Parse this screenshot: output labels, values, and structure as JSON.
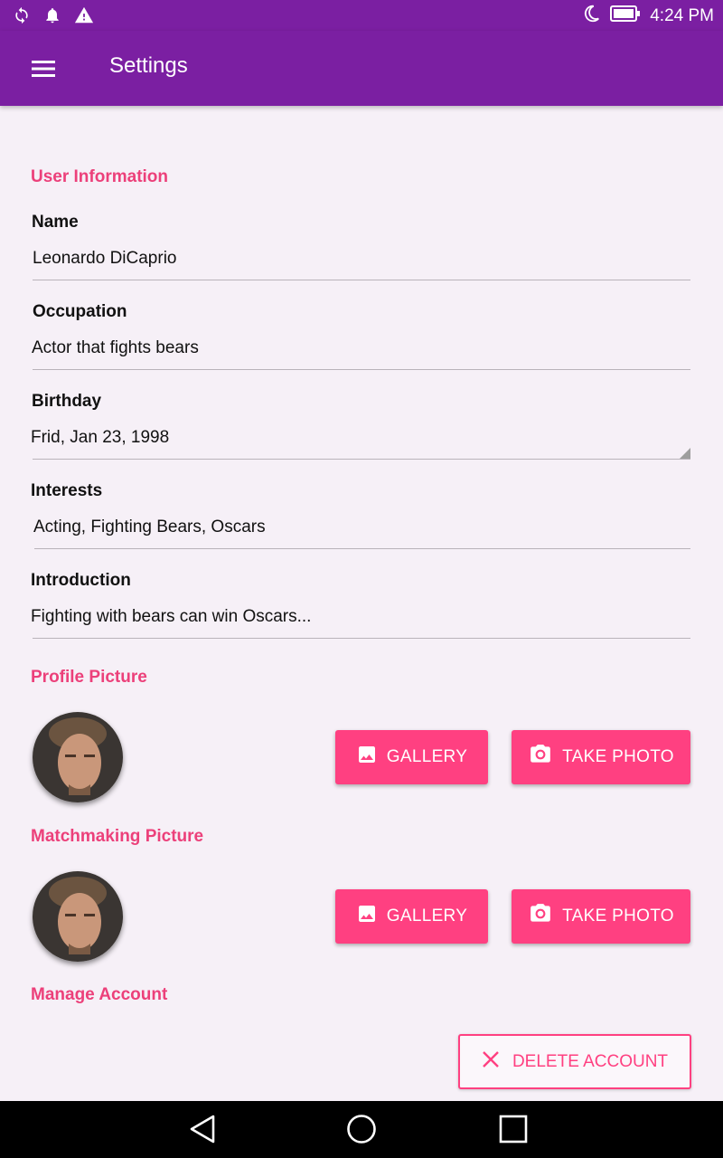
{
  "status_bar": {
    "time": "4:24 PM",
    "icons": [
      "sync-icon",
      "notification-bell-icon",
      "warning-icon",
      "do-not-disturb-moon-icon",
      "battery-icon"
    ]
  },
  "app_bar": {
    "menu_icon": "hamburger-menu-icon",
    "title": "Settings"
  },
  "user_information": {
    "header": "User Information",
    "name": {
      "label": "Name",
      "value": "Leonardo DiCaprio"
    },
    "occupation": {
      "label": "Occupation",
      "value": "Actor that fights bears"
    },
    "birthday": {
      "label": "Birthday",
      "value": "Frid, Jan 23, 1998"
    },
    "interests": {
      "label": "Interests",
      "value": "Acting, Fighting Bears, Oscars"
    },
    "introduction": {
      "label": "Introduction",
      "value": "Fighting with bears can win Oscars..."
    }
  },
  "profile_picture": {
    "header": "Profile Picture",
    "gallery_label": "GALLERY",
    "take_photo_label": "TAKE PHOTO"
  },
  "matchmaking_picture": {
    "header": "Matchmaking Picture",
    "gallery_label": "GALLERY",
    "take_photo_label": "TAKE PHOTO"
  },
  "manage_account": {
    "header": "Manage Account",
    "delete_label": "DELETE ACCOUNT"
  },
  "nav_bar": {
    "icons": [
      "back-triangle-icon",
      "home-circle-icon",
      "recents-square-icon"
    ]
  },
  "colors": {
    "primary": "#7b1fa2",
    "accent": "#ff4081",
    "section_header": "#ec407a",
    "background": "#f6f0f7"
  }
}
